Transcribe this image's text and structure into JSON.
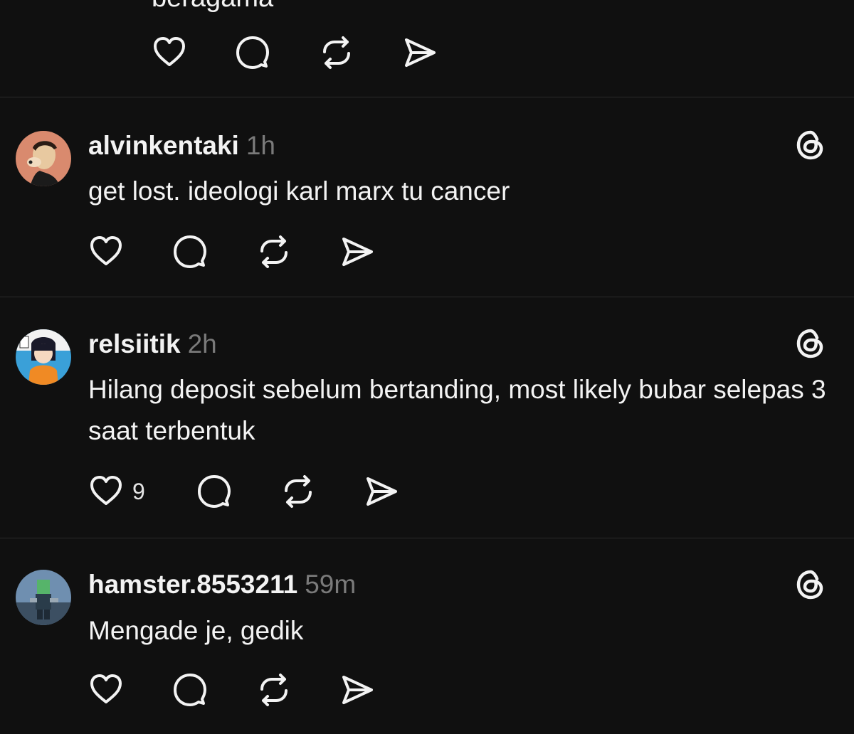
{
  "previous_post": {
    "text_fragment": "beragama"
  },
  "posts": [
    {
      "username": "alvinkentaki",
      "time": "1h",
      "text": "get lost. ideologi karl marx tu cancer",
      "like_count": ""
    },
    {
      "username": "relsiitik",
      "time": "2h",
      "text": "Hilang deposit sebelum bertanding, most likely bubar selepas 3 saat terbentuk",
      "like_count": "9"
    },
    {
      "username": "hamster.8553211",
      "time": "59m",
      "text": "Mengade je, gedik",
      "like_count": ""
    }
  ],
  "icons": {
    "like": "heart-icon",
    "reply": "comment-bubble-icon",
    "repost": "repost-arrows-icon",
    "share": "send-plane-icon",
    "brand": "threads-logo-icon"
  },
  "colors": {
    "background": "#101010",
    "text": "#f3f3f3",
    "muted": "#7a7a7a",
    "divider": "#2a2a2a"
  }
}
